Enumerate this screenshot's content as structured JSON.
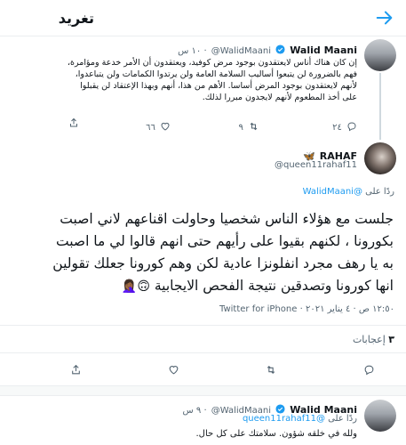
{
  "header": {
    "title": "تغريد"
  },
  "tweet_top": {
    "name": "Walid Maani",
    "handle": "@WalidMaani",
    "time": "١٠ س ·",
    "lines": [
      "إن كان هناك أناس لايعتقدون بوجود مرض كوفيد، ويعتقدون أن الأمر خدعة ومؤامرة،",
      "فهم بالضرورة لن يتبعوا أساليب السلامة العامة ولن يرتدوا الكمامات ولن يتباعدوا،",
      "لأنهم لايعتقدون بوجود المرض أساسا. الأهم من هذا، أنهم وبهذا الإعتقاد لن يقبلوا",
      "على أخذ المطعوم لأنهم لايجدون مبررا لذلك."
    ],
    "replies": "٢٤",
    "retweets": "٩",
    "likes": "٦٦"
  },
  "main_tweet": {
    "name": "RAHAF",
    "name_emoji": "🦋",
    "handle": "@queen11rahaf11",
    "reply_prefix": "ردًا على",
    "reply_to": "@WalidMaani",
    "lines": [
      "جلست مع هؤلاء الناس شخصيا وحاولت اقناعهم لاني اصبت",
      "بكورونا ، لكنهم بقيوا على رأيهم حتى انهم قالوا لي ما اصبت",
      "به يا رهف مجرد انفلونزا عادية  لكن وهم كورونا جعلك تقولين",
      "انها كورونا وتصدقين نتيجة الفحص الايجابية"
    ],
    "emojis": "🙃🤦🏾‍♀️",
    "timestamp": "١٢:٥٠ ص · ٤ يناير ٢٠٢١",
    "source": "Twitter for iPhone",
    "likes_count": "٣",
    "likes_label": "إعجابات"
  },
  "reply_tweet": {
    "name": "Walid Maani",
    "handle": "@WalidMaani",
    "time": "٩ س ·",
    "reply_prefix": "ردًا على",
    "reply_to": "@queen11rahaf11",
    "text": "ولله في خلقه شؤون. سلامتك على كل حال."
  }
}
